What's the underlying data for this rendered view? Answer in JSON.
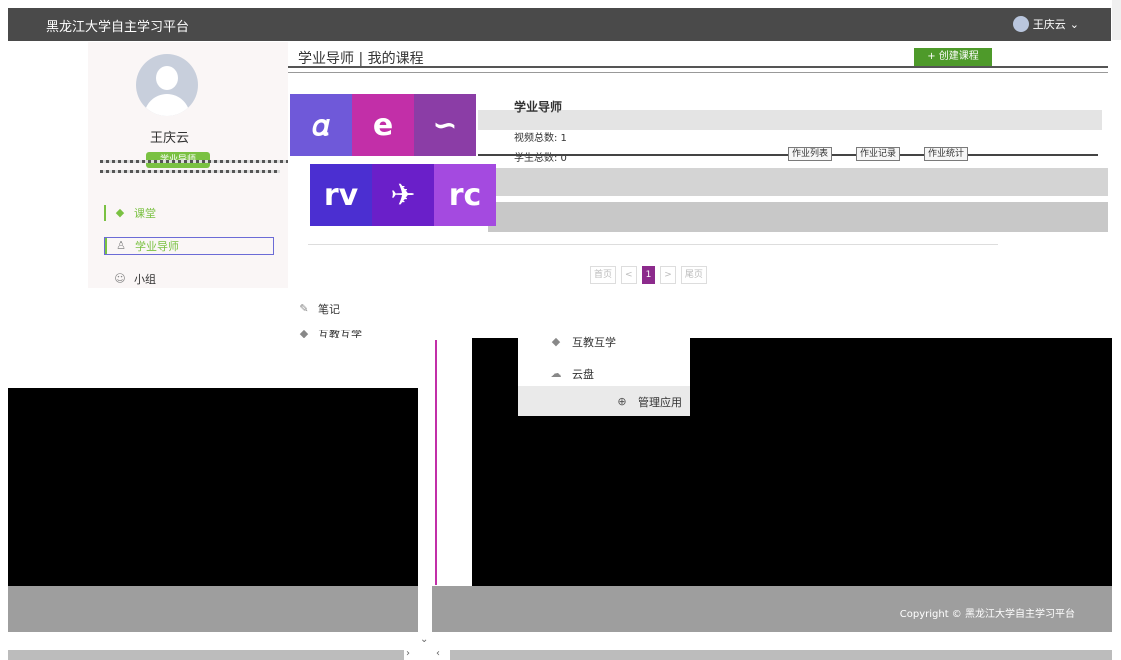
{
  "topbar": {
    "brand": "黑龙江大学自主学习平台",
    "user": "王庆云"
  },
  "profile": {
    "name": "王庆云",
    "badge": "学业导师"
  },
  "sidebar": {
    "items": [
      {
        "label": "课堂",
        "icon": "class-icon"
      },
      {
        "label": "学业导师",
        "icon": "tutor-icon"
      },
      {
        "label": "小组",
        "icon": "group-icon"
      },
      {
        "label": "笔记",
        "icon": "note-icon"
      },
      {
        "label": "互教互学",
        "icon": "peer-icon"
      }
    ]
  },
  "main": {
    "title": "学业导师 | 我的课程",
    "create_button": "+ 创建课程",
    "course": {
      "name": "学业导师",
      "stat1": "视频总数: 1",
      "stat2": "学生总数: 0"
    },
    "actions": [
      "作业列表",
      "作业记录",
      "作业统计"
    ]
  },
  "pager": {
    "first": "首页",
    "prev": "<",
    "current": "1",
    "next": ">",
    "last": "尾页"
  },
  "dropdown": {
    "items": [
      {
        "label": "互教互学",
        "icon": "peer-icon"
      },
      {
        "label": "云盘",
        "icon": "cloud-icon"
      }
    ],
    "manage": "管理应用"
  },
  "footer": {
    "copyright": "Copyright © 黑龙江大学自主学习平台"
  },
  "colors": {
    "accent": "#7ac142",
    "topbar": "#4a4a4a",
    "pager_active": "#8c2a8c"
  }
}
